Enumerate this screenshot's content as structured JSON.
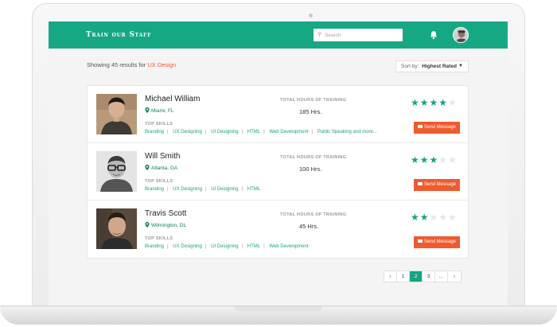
{
  "header": {
    "logo": "Train our Staff",
    "search_placeholder": "Search",
    "brand_color": "#16a882"
  },
  "results": {
    "prefix": "Showing 45 results for",
    "query": "UX Design",
    "query_color": "#ef5a2e"
  },
  "sort": {
    "label": "Sort by:",
    "value": "Highest Rated"
  },
  "labels": {
    "hours_heading": "TOTAL HOURS OF TRAINING",
    "skills_heading": "TOP SKILLS",
    "message_button": "Send Message"
  },
  "people": [
    {
      "name": "Michael William",
      "location": "Miami, FL",
      "hours": "185 Hrs.",
      "rating": 4,
      "skills": [
        "Branding",
        "UX Designing",
        "UI Designing",
        "HTML",
        "Web Development",
        "Public Speaking and more..."
      ]
    },
    {
      "name": "Will Smith",
      "location": "Atlanta, GA",
      "hours": "100 Hrs.",
      "rating": 3,
      "skills": [
        "Branding",
        "UX Designing",
        "UI Designing",
        "HTML"
      ]
    },
    {
      "name": "Travis Scott",
      "location": "Wilmington, DL",
      "hours": "45 Hrs.",
      "rating": 2,
      "skills": [
        "Branding",
        "UX Designing",
        "UI Designing",
        "HTML",
        "Web Development"
      ]
    }
  ],
  "pagination": {
    "prev_icon": "‹",
    "pages": [
      "1",
      "2",
      "3",
      "..."
    ],
    "active": "2",
    "next_icon": "›"
  }
}
